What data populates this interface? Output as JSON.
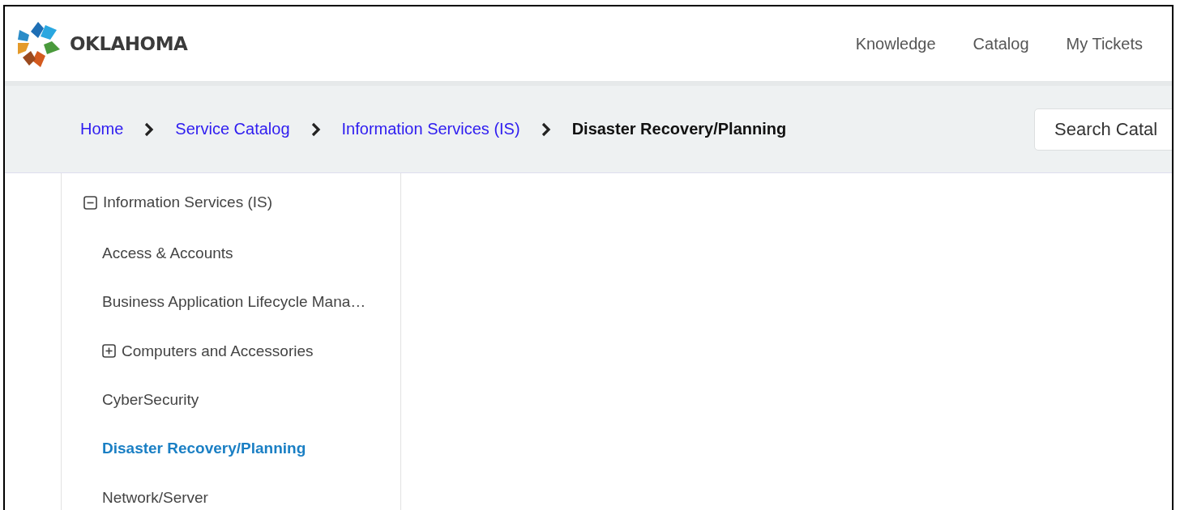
{
  "header": {
    "brand": "OKLAHOMA",
    "nav": [
      {
        "label": "Knowledge"
      },
      {
        "label": "Catalog"
      },
      {
        "label": "My Tickets"
      }
    ]
  },
  "breadcrumbs": [
    {
      "label": "Home",
      "current": false
    },
    {
      "label": "Service Catalog",
      "current": false
    },
    {
      "label": "Information Services (IS)",
      "current": false
    },
    {
      "label": "Disaster Recovery/Planning",
      "current": true
    }
  ],
  "search": {
    "placeholder": "Search Catal"
  },
  "sidebar": {
    "items": [
      {
        "label": "Information Services (IS)",
        "expanded": true,
        "selected": false,
        "children": [
          {
            "label": "Access & Accounts",
            "selected": false
          },
          {
            "label": "Business Application Lifecycle Mana…",
            "selected": false
          },
          {
            "label": "Computers and Accessories",
            "expanded": false,
            "selected": false
          },
          {
            "label": "CyberSecurity",
            "selected": false
          },
          {
            "label": "Disaster Recovery/Planning",
            "selected": true
          },
          {
            "label": "Network/Server",
            "selected": false
          }
        ]
      }
    ]
  }
}
